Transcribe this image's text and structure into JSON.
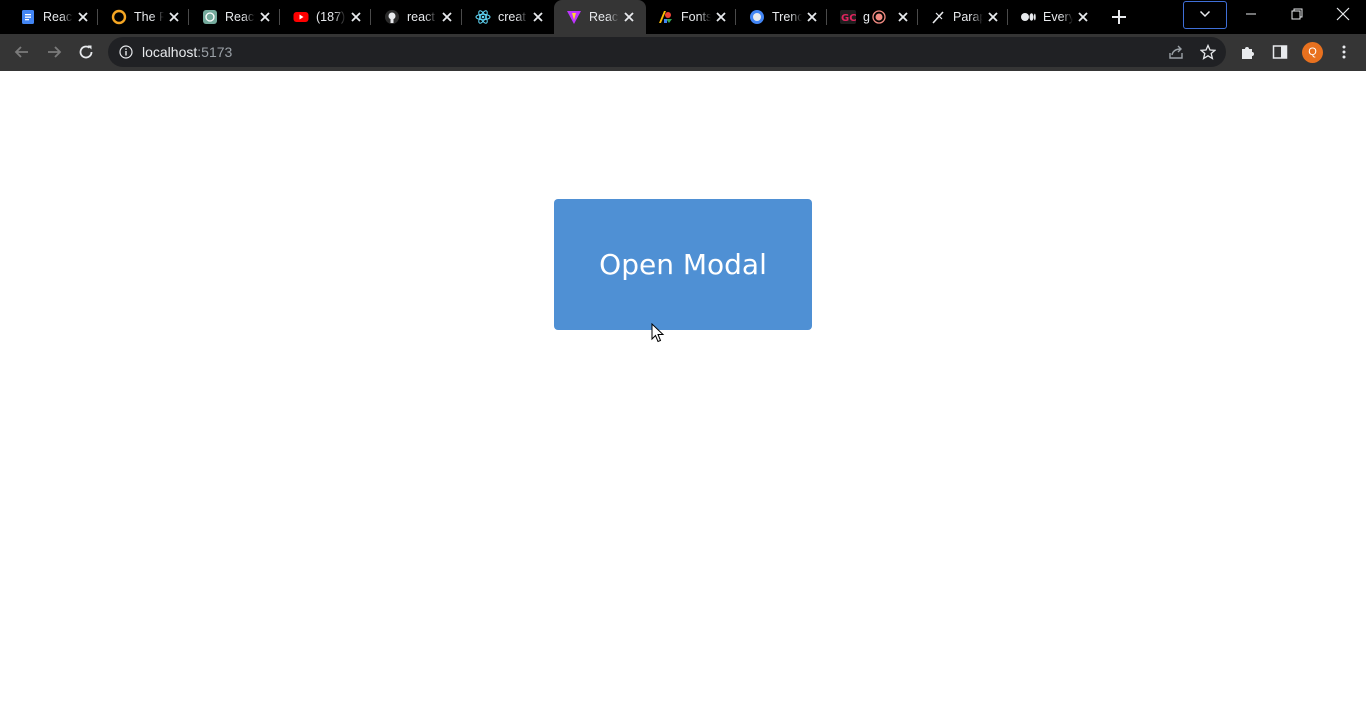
{
  "browser": {
    "tabs": [
      {
        "title": "React",
        "icon": "docs-icon",
        "color": "#4285f4"
      },
      {
        "title": "The R",
        "icon": "ring-icon",
        "color": "#f5a623"
      },
      {
        "title": "React",
        "icon": "chatgpt-icon",
        "color": "#74aa9c"
      },
      {
        "title": "(187)",
        "icon": "youtube-icon",
        "color": "#ff0000"
      },
      {
        "title": "react",
        "icon": "github-icon",
        "color": "#ffffff"
      },
      {
        "title": "creat",
        "icon": "react-icon",
        "color": "#61dafb"
      },
      {
        "title": "React",
        "icon": "vite-icon",
        "color": "#bd34fe",
        "active": true
      },
      {
        "title": "Fonts",
        "icon": "google-fonts-icon",
        "color": "#4285f4"
      },
      {
        "title": "Trenc",
        "icon": "trends-icon",
        "color": "#4285f4"
      },
      {
        "title": "g",
        "icon": "gc-icon",
        "color": "#e0245e"
      },
      {
        "title": "Parap",
        "icon": "feather-icon",
        "color": "#ffffff"
      },
      {
        "title": "Every",
        "icon": "medium-icon",
        "color": "#ffffff"
      }
    ],
    "address": {
      "host": "localhost",
      "port": ":5173"
    },
    "profile_initial": "Q",
    "accent": "#3f6fd8"
  },
  "page": {
    "button_label": "Open Modal",
    "button_color": "#4f90d4"
  }
}
